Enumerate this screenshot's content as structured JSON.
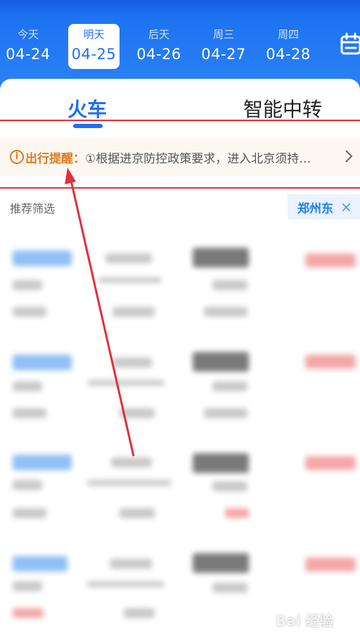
{
  "date_bar": {
    "tabs": [
      {
        "weekday": "今天",
        "date": "04-24"
      },
      {
        "weekday": "明天",
        "date": "04-25",
        "active": true
      },
      {
        "weekday": "后天",
        "date": "04-26"
      },
      {
        "weekday": "周三",
        "date": "04-27"
      },
      {
        "weekday": "周四",
        "date": "04-28"
      }
    ],
    "calendar_icon": "calendar-icon"
  },
  "mode_tabs": {
    "train": "火车",
    "transfer": "智能中转"
  },
  "notice": {
    "icon": "info-icon",
    "icon_glyph": "i",
    "title": "出行提醒：",
    "text": "①根据进京防控政策要求，进入北京须持…",
    "chevron": "chevron-right-icon"
  },
  "filter": {
    "label": "推荐筛选",
    "chip": "郑州东",
    "chip_close": "×"
  },
  "watermark": {
    "text": "Bai 经验"
  },
  "colors": {
    "primary": "#1f6ff0",
    "notice_orange": "#e07a1e",
    "annotation_red": "#e0303a"
  }
}
